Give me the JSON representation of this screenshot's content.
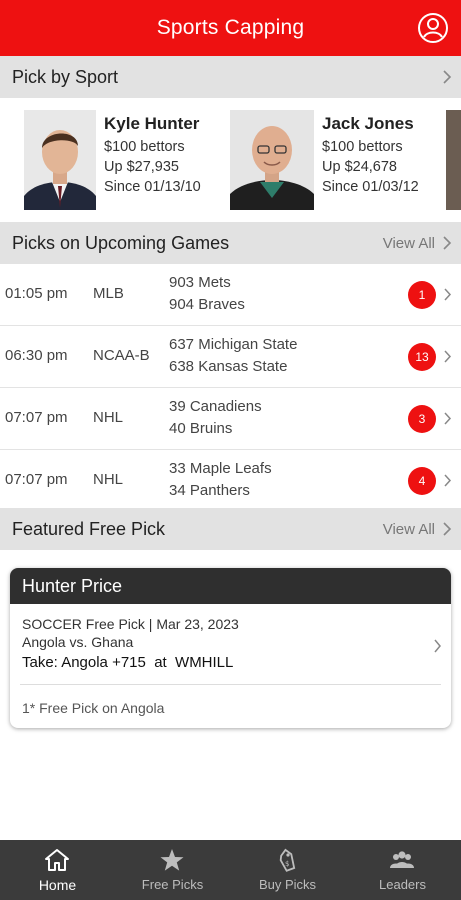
{
  "header": {
    "title": "Sports Capping",
    "profile_icon": "account-circle-icon"
  },
  "pick_by_sport": {
    "label": "Pick by Sport"
  },
  "cappers": [
    {
      "name": "Kyle Hunter",
      "bettors": "$100 bettors",
      "profit": "Up $27,935",
      "since": "Since 01/13/10"
    },
    {
      "name": "Jack Jones",
      "bettors": "$100 bettors",
      "profit": "Up $24,678",
      "since": "Since 01/03/12"
    }
  ],
  "upcoming": {
    "label": "Picks on Upcoming Games",
    "view_all": "View All"
  },
  "games": [
    {
      "time": "01:05 pm",
      "league": "MLB",
      "team1": "903 Mets",
      "team2": "904 Braves",
      "count": "1"
    },
    {
      "time": "06:30 pm",
      "league": "NCAA-B",
      "team1": "637 Michigan State",
      "team2": "638 Kansas State",
      "count": "13"
    },
    {
      "time": "07:07 pm",
      "league": "NHL",
      "team1": "39 Canadiens",
      "team2": "40 Bruins",
      "count": "3"
    },
    {
      "time": "07:07 pm",
      "league": "NHL",
      "team1": "33 Maple Leafs",
      "team2": "34 Panthers",
      "count": "4"
    }
  ],
  "featured": {
    "label": "Featured Free Pick",
    "view_all": "View All",
    "capper": "Hunter Price",
    "line1": "SOCCER Free Pick | Mar 23, 2023",
    "line2": "Angola vs. Ghana",
    "line3": "Take: Angola +715  at  WMHILL",
    "footnote": "1* Free Pick on Angola"
  },
  "tabs": [
    {
      "label": "Home",
      "icon": "home-icon",
      "active": true
    },
    {
      "label": "Free Picks",
      "icon": "star-icon",
      "active": false
    },
    {
      "label": "Buy Picks",
      "icon": "price-tag-icon",
      "active": false
    },
    {
      "label": "Leaders",
      "icon": "group-icon",
      "active": false
    }
  ],
  "colors": {
    "brand_red": "#ee1111",
    "tabbar": "#3b3b3b",
    "section_bg": "#e2e2e2",
    "card_header": "#2f2f2f"
  }
}
